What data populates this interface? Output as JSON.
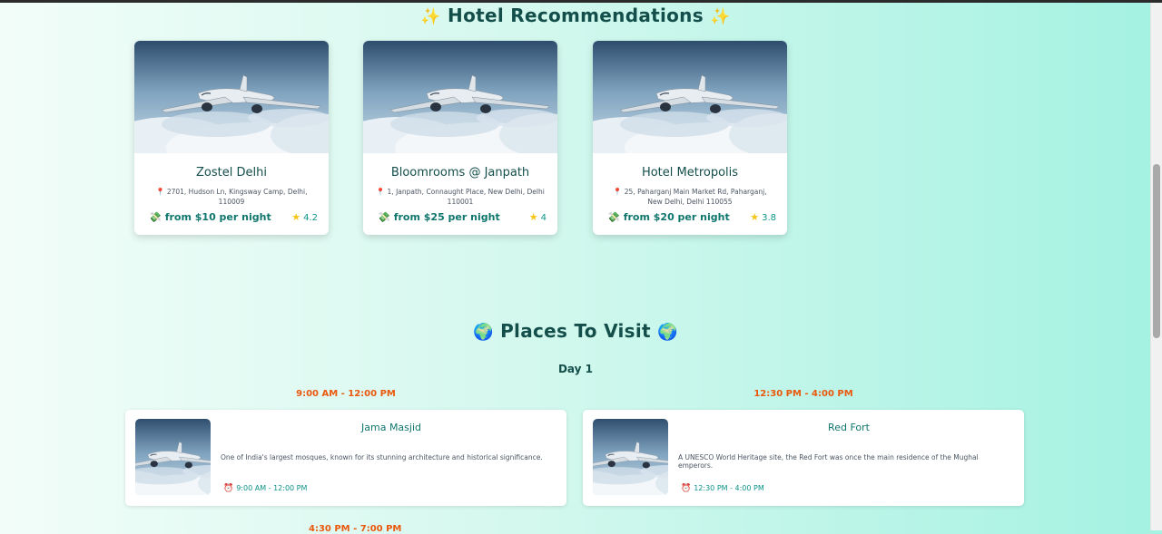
{
  "hotels_section": {
    "title": "Hotel Recommendations",
    "title_icon": "sparkles-icon",
    "hotels": [
      {
        "name": "Zostel Delhi",
        "address": "2701, Hudson Ln, Kingsway Camp, Delhi, 110009",
        "price": "from $10 per night",
        "rating": "4.2"
      },
      {
        "name": "Bloomrooms @ Janpath",
        "address": "1, Janpath, Connaught Place, New Delhi, Delhi 110001",
        "price": "from $25 per night",
        "rating": "4"
      },
      {
        "name": "Hotel Metropolis",
        "address": "25, Paharganj Main Market Rd, Paharganj, New Delhi, Delhi 110055",
        "price": "from $20 per night",
        "rating": "3.8"
      }
    ]
  },
  "places_section": {
    "title": "Places To Visit",
    "title_icon": "globe-icon",
    "days": [
      {
        "label": "Day 1",
        "places": [
          {
            "time_slot": "9:00 AM - 12:00 PM",
            "name": "Jama Masjid",
            "description": "One of India's largest mosques, known for its stunning architecture and historical significance.",
            "time": "9:00 AM - 12:00 PM"
          },
          {
            "time_slot": "12:30 PM - 4:00 PM",
            "name": "Red Fort",
            "description": "A UNESCO World Heritage site, the Red Fort was once the main residence of the Mughal emperors.",
            "time": "12:30 PM - 4:00 PM"
          }
        ],
        "next_time_slot": "4:30 PM - 7:00 PM"
      }
    ]
  },
  "colors": {
    "heading": "#134e4a",
    "time_accent": "#ea580c",
    "teal_text": "#0f766e"
  }
}
